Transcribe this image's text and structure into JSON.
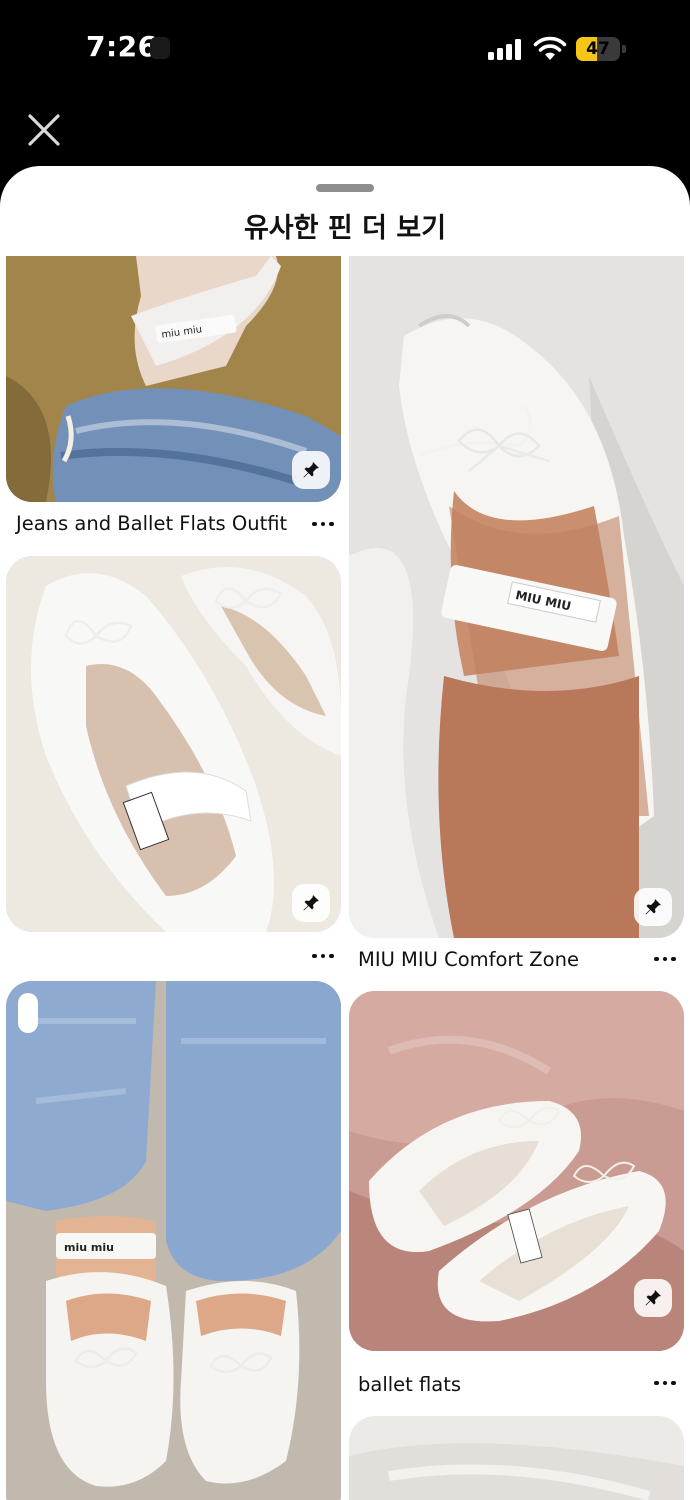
{
  "status_bar": {
    "time": "7:26",
    "battery_level": "47",
    "battery_percent": 47
  },
  "sheet": {
    "title": "유사한 핀 더 보기"
  },
  "pins": [
    {
      "id": "pin-jeans-ballet",
      "title": "Jeans and Ballet Flats Outfit",
      "icon": "pushpin-icon",
      "more_icon": "ellipsis-icon"
    },
    {
      "id": "pin-miu-comfort",
      "title": "MIU MIU Comfort Zone",
      "icon": "pushpin-icon",
      "more_icon": "ellipsis-icon"
    },
    {
      "id": "pin-white-flats",
      "title": "",
      "icon": "pushpin-icon",
      "more_icon": "ellipsis-icon"
    },
    {
      "id": "pin-ballet-flats",
      "title": "ballet flats",
      "icon": "pushpin-icon",
      "more_icon": "ellipsis-icon"
    },
    {
      "id": "pin-jeans-feet",
      "title": "",
      "icon": "video-badge",
      "more_icon": ""
    },
    {
      "id": "pin-partial",
      "title": "",
      "icon": "",
      "more_icon": ""
    }
  ],
  "colors": {
    "sheet_bg": "#ffffff",
    "status_bg": "#000000",
    "battery": "#f5c518",
    "text": "#111111"
  }
}
